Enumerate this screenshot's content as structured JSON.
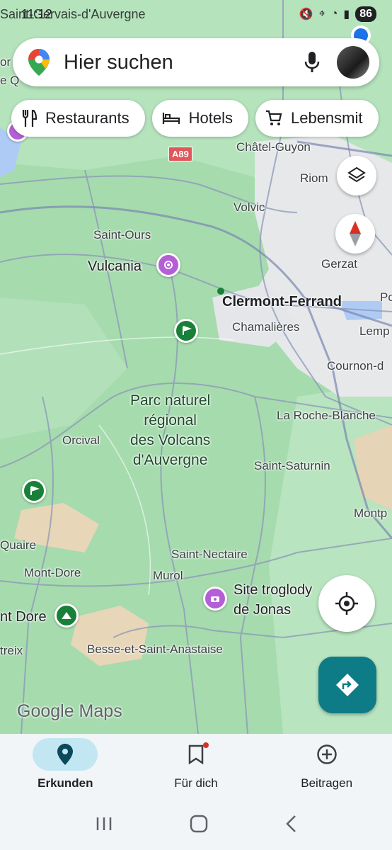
{
  "status_bar": {
    "time": "11:12",
    "overlay_place": "Saint-Gervais-d'Auvergne",
    "battery": "86"
  },
  "search": {
    "placeholder": "Hier suchen",
    "icon": "google-maps-pin-icon",
    "mic_icon": "microphone-icon"
  },
  "chips": [
    {
      "label": "Restaurants",
      "icon": "fork-knife-icon"
    },
    {
      "label": "Hotels",
      "icon": "bed-icon"
    },
    {
      "label": "Lebensmit",
      "icon": "cart-icon"
    }
  ],
  "map": {
    "road_shield": "A89",
    "places": {
      "chatel_guyon": "Châtel-Guyon",
      "riom": "Riom",
      "volvic": "Volvic",
      "saint_ours": "Saint-Ours",
      "vulcania": "Vulcania",
      "gerzat": "Gerzat",
      "clermont": "Clermont-Ferrand",
      "chamalieres": "Chamalières",
      "lemp": "Lemp",
      "po": "Po",
      "cournon": "Cournon-d",
      "park_line1": "Parc naturel",
      "park_line2": "régional",
      "park_line3": "des Volcans",
      "park_line4": "d'Auvergne",
      "la_roche": "La Roche-Blanche",
      "orcival": "Orcival",
      "saint_saturnin": "Saint-Saturnin",
      "montp": "Montp",
      "quaire": "Quaire",
      "saint_nectaire": "Saint-Nectaire",
      "mont_dore": "Mont-Dore",
      "murol": "Murol",
      "site_trog_1": "Site troglody",
      "site_trog_2": "de Jonas",
      "nt_dore": "nt Dore",
      "treix": "treix",
      "besse": "Besse-et-Saint-Anastaise",
      "left_top_1": "or",
      "left_top_2": "e Q"
    },
    "attribution": "Google Maps"
  },
  "bottom_nav": [
    {
      "label": "Erkunden",
      "icon": "location-pin-icon",
      "active": true
    },
    {
      "label": "Für dich",
      "icon": "bookmark-icon",
      "active": false,
      "badge": true
    },
    {
      "label": "Beitragen",
      "icon": "add-circle-icon",
      "active": false
    }
  ],
  "colors": {
    "map_green": "#a8dcb0",
    "urban": "#e8eaed",
    "directions": "#0e7c86",
    "active_nav": "#c2e7f2"
  }
}
